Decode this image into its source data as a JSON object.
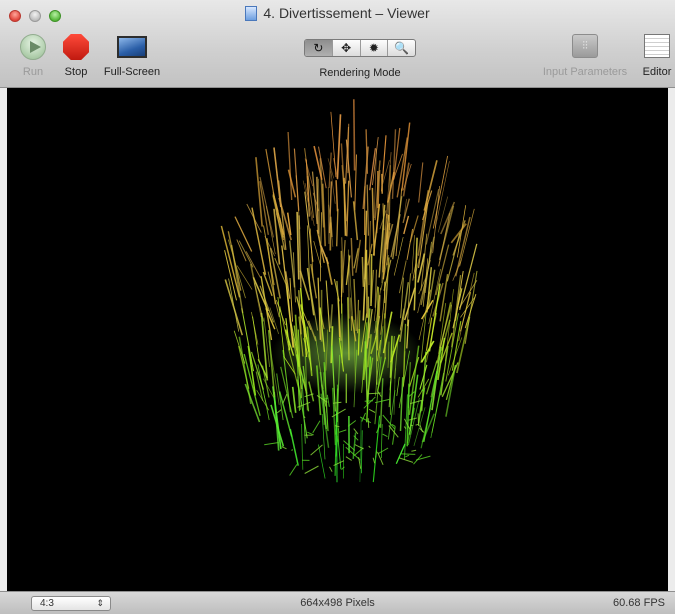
{
  "window": {
    "title": "4. Divertissement – Viewer"
  },
  "toolbar": {
    "run_label": "Run",
    "stop_label": "Stop",
    "fullscreen_label": "Full-Screen",
    "rendering_mode_label": "Rendering Mode",
    "rendering_modes": [
      "↻",
      "✥",
      "✹",
      "🔍"
    ],
    "input_parameters_label": "Input Parameters",
    "editor_label": "Editor"
  },
  "status": {
    "aspect_ratio": "4:3",
    "resolution": "664x498 Pixels",
    "fps": "60.68 FPS"
  },
  "colors": {
    "viewer_background": "#000000",
    "strand_top": "#d4a24a",
    "strand_bottom": "#7cff3a"
  }
}
